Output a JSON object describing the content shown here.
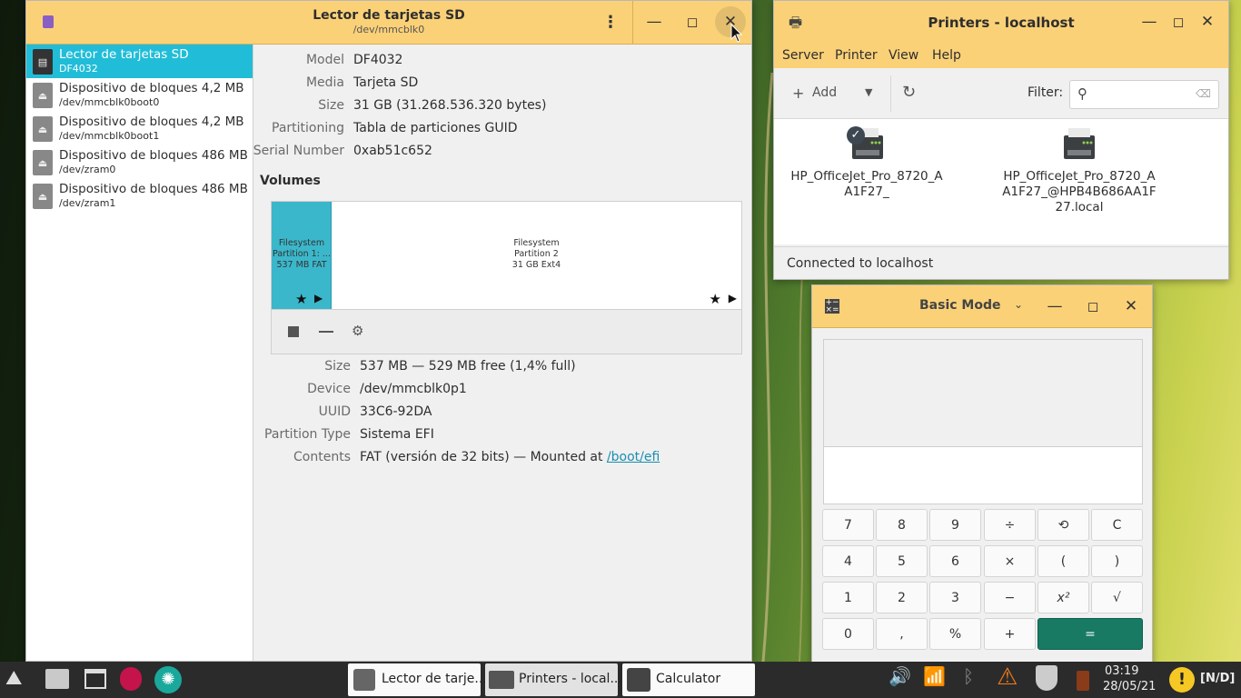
{
  "disks": {
    "title": "Lector de tarjetas SD",
    "subtitle": "/dev/mmcblk0",
    "sidebar": [
      {
        "name": "Lector de tarjetas SD",
        "sub": "DF4032"
      },
      {
        "name": "Dispositivo de bloques 4,2 MB",
        "sub": "/dev/mmcblk0boot0"
      },
      {
        "name": "Dispositivo de bloques 4,2 MB",
        "sub": "/dev/mmcblk0boot1"
      },
      {
        "name": "Dispositivo de bloques 486 MB",
        "sub": "/dev/zram0"
      },
      {
        "name": "Dispositivo de bloques 486 MB",
        "sub": "/dev/zram1"
      }
    ],
    "props": [
      {
        "k": "Model",
        "v": "DF4032"
      },
      {
        "k": "Media",
        "v": "Tarjeta SD"
      },
      {
        "k": "Size",
        "v": "31 GB (31.268.536.320 bytes)"
      },
      {
        "k": "Partitioning",
        "v": "Tabla de particiones GUID"
      },
      {
        "k": "Serial Number",
        "v": "0xab51c652"
      }
    ],
    "volumes_heading": "Volumes",
    "partitions": [
      {
        "l1": "Filesystem",
        "l2": "Partition 1: ...",
        "l3": "537 MB FAT"
      },
      {
        "l1": "Filesystem",
        "l2": "Partition 2",
        "l3": "31 GB Ext4"
      }
    ],
    "vprops": [
      {
        "k": "Size",
        "v": "537 MB — 529 MB free (1,4% full)"
      },
      {
        "k": "Device",
        "v": "/dev/mmcblk0p1"
      },
      {
        "k": "UUID",
        "v": "33C6-92DA"
      },
      {
        "k": "Partition Type",
        "v": "Sistema EFI"
      },
      {
        "k": "Contents",
        "v": "FAT (versión de 32 bits) — Mounted at ",
        "link": "/boot/efi"
      }
    ]
  },
  "printers": {
    "title": "Printers - localhost",
    "menu": [
      "Server",
      "Printer",
      "View",
      "Help"
    ],
    "add_label": "Add",
    "filter_label": "Filter:",
    "filter_placeholder": "",
    "items": [
      {
        "name": "HP_OfficeJet_Pro_8720_AA1F27_",
        "default": true
      },
      {
        "name": "HP_OfficeJet_Pro_8720_AA1F27_@HPB4B686AA1F27.local",
        "default": false
      }
    ],
    "status": "Connected to localhost"
  },
  "calc": {
    "title": "Basic Mode",
    "keys": [
      [
        "7",
        "8",
        "9",
        "÷",
        "⟲",
        "C"
      ],
      [
        "4",
        "5",
        "6",
        "×",
        "(",
        ")"
      ],
      [
        "1",
        "2",
        "3",
        "−",
        "x²",
        "√"
      ],
      [
        "0",
        ",",
        "%",
        "+",
        "="
      ]
    ]
  },
  "taskbar": {
    "tasks": [
      "Lector de tarje...",
      "Printers - local...",
      "Calculator"
    ],
    "time": "03:19",
    "date": "28/05/21",
    "nd": "[N/D]"
  },
  "colors": {
    "titlebar": "#fbd178",
    "accent": "#21bdd8",
    "equals": "#187a63"
  }
}
